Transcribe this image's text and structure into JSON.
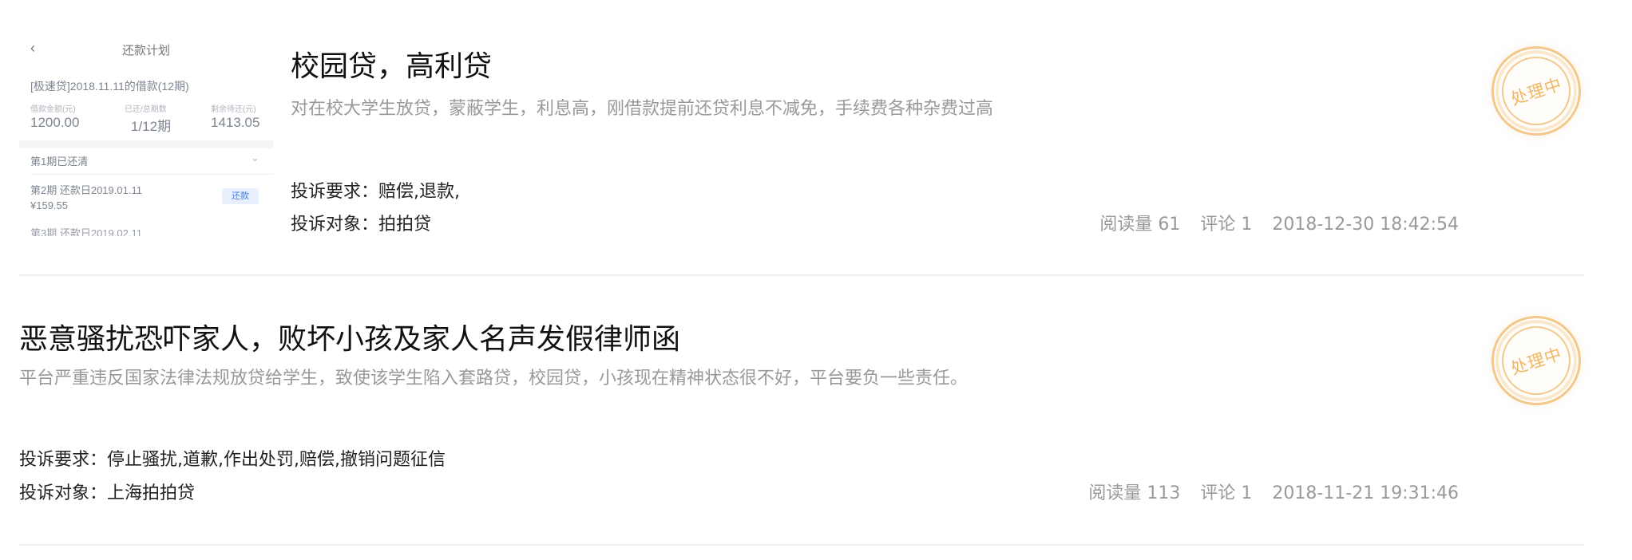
{
  "complaints": [
    {
      "title": "校园贷，高利贷",
      "description": "对在校大学生放贷，蒙蔽学生，利息高，刚借款提前还贷利息不减免，手续费各种杂费过高",
      "demand": "投诉要求：赔偿,退款,",
      "target": "投诉对象：拍拍贷",
      "views": "阅读量 61",
      "comments": "评论 1",
      "time": "2018-12-30 18:42:54",
      "status": "处理中",
      "thumbnail": {
        "back_icon": "chevron-left",
        "title": "还款计划",
        "loan": "[极速贷]2018.11.11的借款(12期)",
        "labels": [
          "借款金额(元)",
          "已还/总期数",
          "剩余待还(元)"
        ],
        "values": [
          "1200.00",
          "1/12期",
          "1413.05"
        ],
        "paid": "第1期已还清",
        "period2": "第2期   还款日2019.01.11",
        "amount2": "¥159.55",
        "repay_button": "还款",
        "period3": "第3期   还款日2019.02.11"
      }
    },
    {
      "title": "恶意骚扰恐吓家人，败坏小孩及家人名声发假律师函",
      "description": "平台严重违反国家法律法规放贷给学生，致使该学生陷入套路贷，校园贷，小孩现在精神状态很不好，平台要负一些责任。",
      "demand": "投诉要求：停止骚扰,道歉,作出处罚,赔偿,撤销问题征信",
      "target": "投诉对象：上海拍拍贷",
      "views": "阅读量 113",
      "comments": "评论 1",
      "time": "2018-11-21 19:31:46",
      "status": "处理中"
    }
  ],
  "colors": {
    "title": "#111111",
    "desc": "#999999",
    "meta": "#999999",
    "stamp": "#f0b667",
    "divider": "#eeeeee"
  }
}
